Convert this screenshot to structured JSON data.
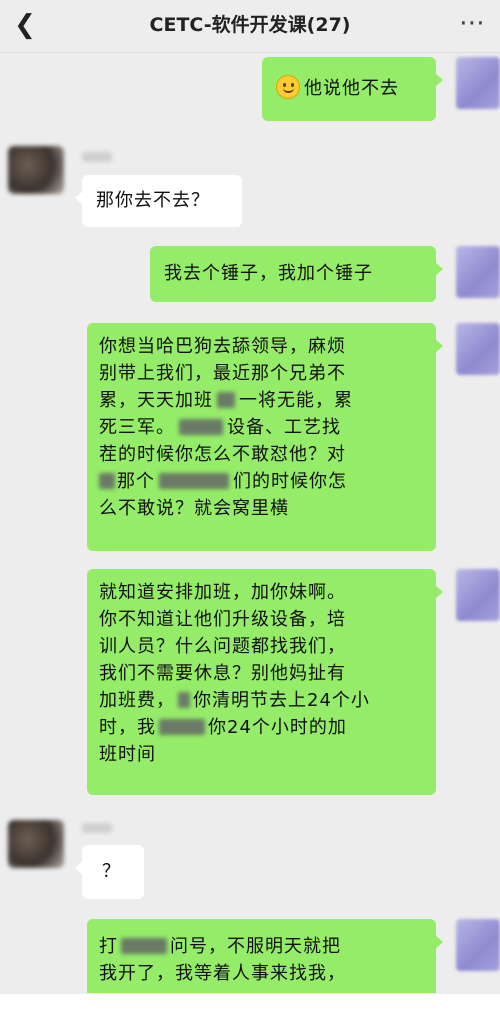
{
  "header": {
    "back_icon": "chevron-left-icon",
    "title": "CETC-软件开发课(27)",
    "more_icon": "more-dots-icon"
  },
  "messages": [
    {
      "side": "out",
      "emoji": "smiley-face",
      "text": "他说他不去"
    },
    {
      "side": "in",
      "text": "那你去不去？"
    },
    {
      "side": "out",
      "text": "我去个锤子，我加个锤子"
    },
    {
      "side": "out",
      "lines": [
        "你想当哈巴狗去舔领导，麻烦",
        "别带上我们，最近那个兄弟不",
        "累，天天加班",
        "一将无能，累",
        "死三军。",
        "设备、工艺找",
        "茬的时候你怎么不敢怼他？对",
        "那个",
        "们的时候你怎",
        "么不敢说？就会窝里横"
      ]
    },
    {
      "side": "out",
      "lines": [
        "就知道安排加班，加你妹啊。",
        "你不知道让他们升级设备，培",
        "训人员？什么问题都找我们，",
        "我们不需要休息？别他妈扯有",
        "加班费，",
        "你清明节去上24个小",
        "时，我",
        "你24个小时的加",
        "班时间"
      ]
    },
    {
      "side": "in",
      "text": "？"
    },
    {
      "side": "out",
      "lines": [
        "打",
        "问号，不服明天就把",
        "我开了，我等着人事来找我，"
      ]
    }
  ]
}
